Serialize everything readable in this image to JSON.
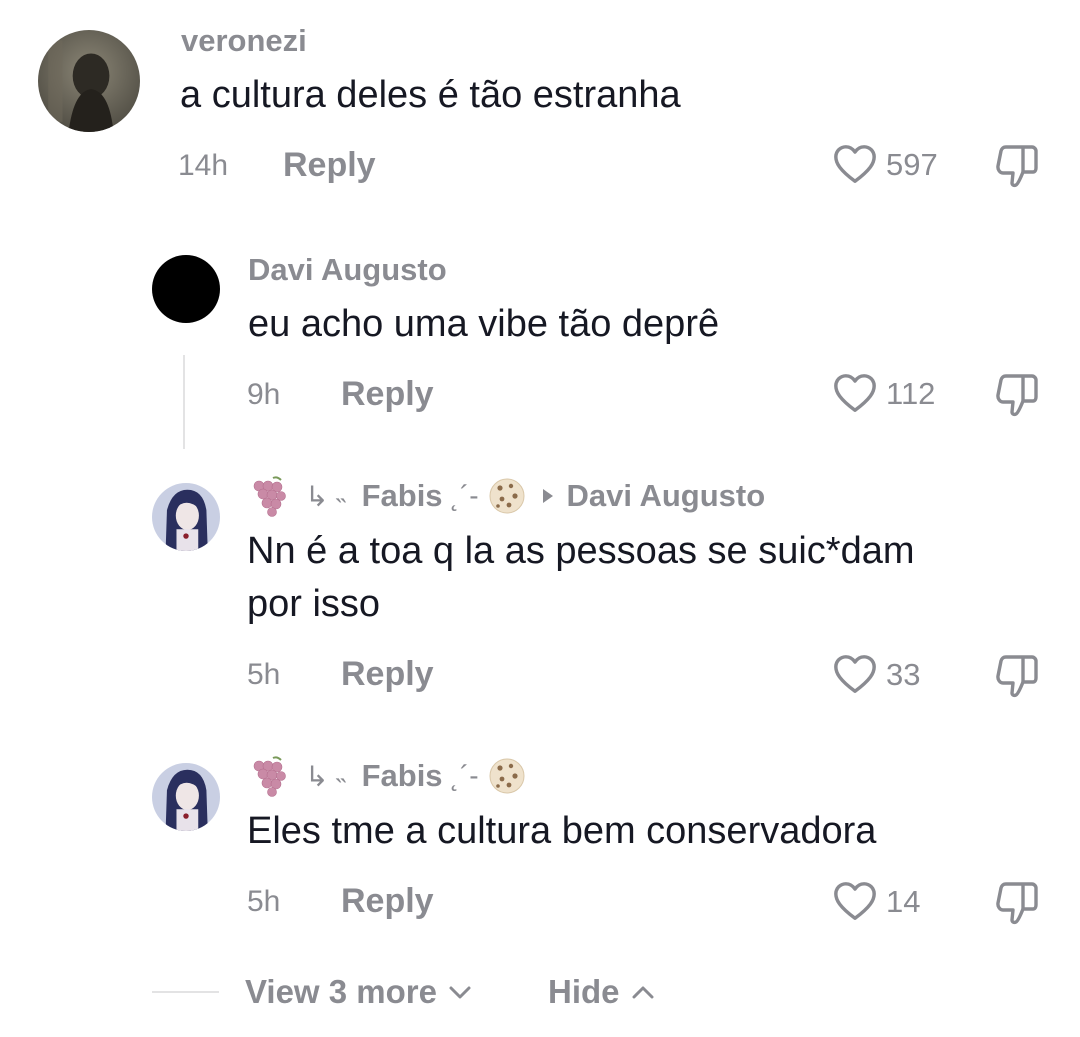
{
  "comments": [
    {
      "username": "veronezi",
      "text": "a cultura deles é tão estranha",
      "time": "14h",
      "reply_label": "Reply",
      "likes": "597"
    },
    {
      "username": "Davi Augusto",
      "text": "eu acho uma vibe tão deprê",
      "time": "9h",
      "reply_label": "Reply",
      "likes": "112"
    },
    {
      "username": "Fabis",
      "username_prefix": "↳ ˵",
      "username_suffix": "˛´-",
      "reply_to": "Davi Augusto",
      "text_line1": "Nn é a toa q la as pessoas se suic*dam",
      "text_line2": "por isso",
      "time": "5h",
      "reply_label": "Reply",
      "likes": "33"
    },
    {
      "username": "Fabis",
      "username_prefix": "↳ ˵",
      "username_suffix": "˛´-",
      "text": "Eles tme a cultura bem conservadora",
      "time": "5h",
      "reply_label": "Reply",
      "likes": "14"
    }
  ],
  "footer": {
    "view_more_label": "View 3 more",
    "hide_label": "Hide"
  },
  "icons": {
    "like": "heart-outline-icon",
    "dislike": "thumbs-down-icon",
    "grapes": "grapes-emoji-icon",
    "cookie": "cookie-emoji-icon",
    "reply_arrow": "caret-right-icon"
  },
  "colors": {
    "text_primary": "#161823",
    "text_secondary": "#8a8b91",
    "divider": "#e3e3e4"
  }
}
